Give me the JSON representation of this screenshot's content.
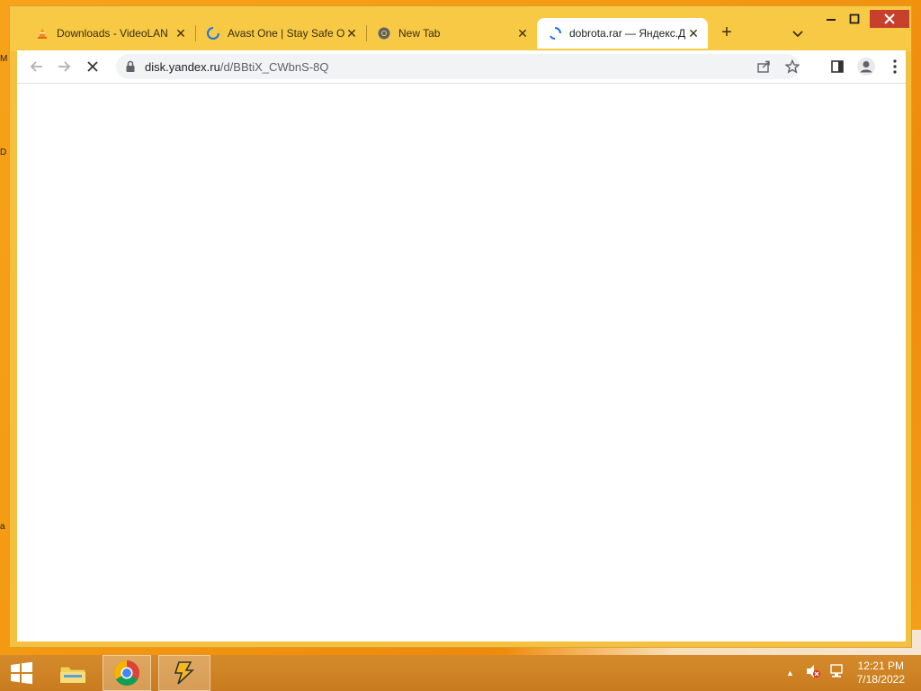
{
  "desktop": {
    "edge_letters": [
      "M",
      "D",
      "a"
    ]
  },
  "browser": {
    "tabs": [
      {
        "title": "Downloads - VideoLAN",
        "favicon": "vlc-cone-icon",
        "active": false
      },
      {
        "title": "Avast One | Stay Safe O",
        "favicon": "loading-spinner-icon",
        "active": false
      },
      {
        "title": "New Tab",
        "favicon": "chrome-icon",
        "active": false
      },
      {
        "title": "dobrota.rar — Яндекс.Д",
        "favicon": "loading-spinner-icon",
        "active": true
      }
    ],
    "new_tab_symbol": "+",
    "address": {
      "host": "disk.yandex.ru",
      "path": "/d/BBtiX_CWbnS-8Q"
    },
    "accent": "#f7c945"
  },
  "taskbar": {
    "clock_time": "12:21 PM",
    "clock_date": "7/18/2022",
    "tray_chevron": "▲"
  }
}
